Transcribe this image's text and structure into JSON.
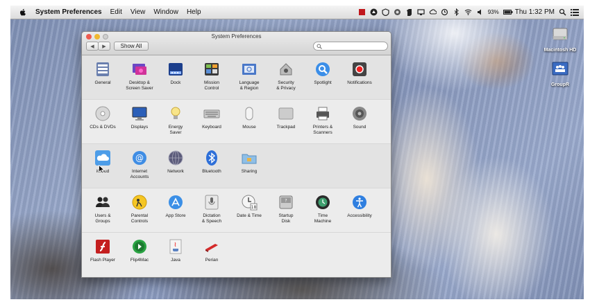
{
  "menubar": {
    "app_name": "System Preferences",
    "menus": [
      "Edit",
      "View",
      "Window",
      "Help"
    ],
    "battery": "93%",
    "clock": "Thu 1:32 PM"
  },
  "desktop": {
    "icons": [
      {
        "label": "Macintosh HD",
        "icon": "hard-drive-icon"
      },
      {
        "label": "GroupR",
        "icon": "network-share-icon"
      }
    ]
  },
  "window": {
    "title": "System Preferences",
    "show_all": "Show All",
    "back_glyph": "◀",
    "forward_glyph": "▶",
    "search_placeholder": ""
  },
  "sections": [
    {
      "items": [
        {
          "label": "General",
          "icon": "general-icon"
        },
        {
          "label": "Desktop &\nScreen Saver",
          "icon": "desktop-screensaver-icon"
        },
        {
          "label": "Dock",
          "icon": "dock-icon"
        },
        {
          "label": "Mission\nControl",
          "icon": "mission-control-icon"
        },
        {
          "label": "Language\n& Region",
          "icon": "language-region-icon"
        },
        {
          "label": "Security\n& Privacy",
          "icon": "security-privacy-icon"
        },
        {
          "label": "Spotlight",
          "icon": "spotlight-icon"
        },
        {
          "label": "Notifications",
          "icon": "notifications-icon"
        }
      ]
    },
    {
      "items": [
        {
          "label": "CDs & DVDs",
          "icon": "cds-dvds-icon"
        },
        {
          "label": "Displays",
          "icon": "displays-icon"
        },
        {
          "label": "Energy\nSaver",
          "icon": "energy-saver-icon"
        },
        {
          "label": "Keyboard",
          "icon": "keyboard-icon"
        },
        {
          "label": "Mouse",
          "icon": "mouse-icon"
        },
        {
          "label": "Trackpad",
          "icon": "trackpad-icon"
        },
        {
          "label": "Printers &\nScanners",
          "icon": "printers-scanners-icon"
        },
        {
          "label": "Sound",
          "icon": "sound-icon"
        }
      ]
    },
    {
      "items": [
        {
          "label": "iCloud",
          "icon": "icloud-icon"
        },
        {
          "label": "Internet\nAccounts",
          "icon": "internet-accounts-icon"
        },
        {
          "label": "Network",
          "icon": "network-icon"
        },
        {
          "label": "Bluetooth",
          "icon": "bluetooth-icon"
        },
        {
          "label": "Sharing",
          "icon": "sharing-icon"
        }
      ]
    },
    {
      "items": [
        {
          "label": "Users &\nGroups",
          "icon": "users-groups-icon"
        },
        {
          "label": "Parental\nControls",
          "icon": "parental-controls-icon"
        },
        {
          "label": "App Store",
          "icon": "app-store-icon"
        },
        {
          "label": "Dictation\n& Speech",
          "icon": "dictation-speech-icon"
        },
        {
          "label": "Date & Time",
          "icon": "date-time-icon"
        },
        {
          "label": "Startup\nDisk",
          "icon": "startup-disk-icon"
        },
        {
          "label": "Time\nMachine",
          "icon": "time-machine-icon"
        },
        {
          "label": "Accessibility",
          "icon": "accessibility-icon"
        }
      ]
    },
    {
      "items": [
        {
          "label": "Flash Player",
          "icon": "flash-player-icon"
        },
        {
          "label": "Flip4Mac",
          "icon": "flip4mac-icon"
        },
        {
          "label": "Java",
          "icon": "java-icon"
        },
        {
          "label": "Perian",
          "icon": "perian-icon"
        }
      ]
    }
  ]
}
